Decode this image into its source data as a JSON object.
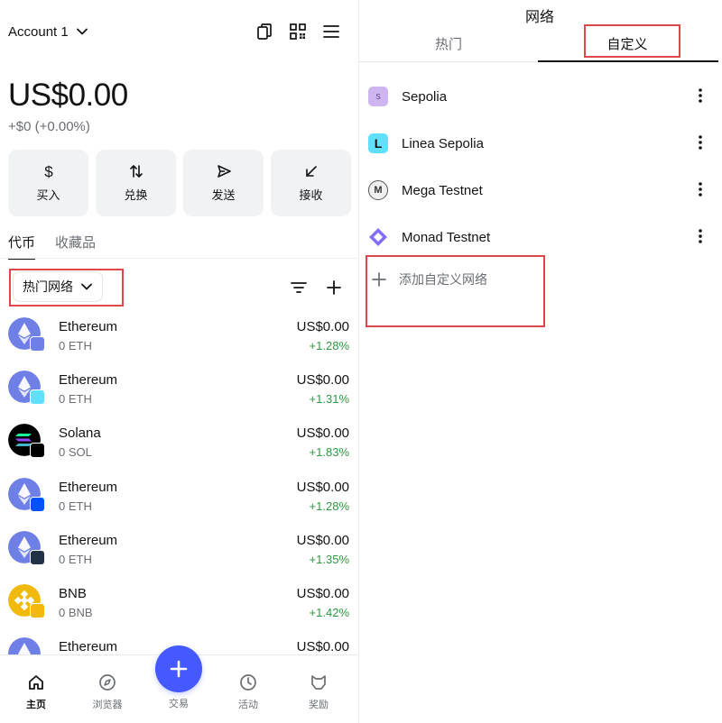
{
  "left": {
    "account": {
      "name": "Account 1"
    },
    "header_icons": [
      "copy-icon",
      "qr-code-icon",
      "menu-icon"
    ],
    "balance": "US$0.00",
    "change": "+$0 (+0.00%)",
    "actions": [
      {
        "label": "买入",
        "icon": "dollar-icon"
      },
      {
        "label": "兑换",
        "icon": "swap-icon"
      },
      {
        "label": "发送",
        "icon": "send-icon"
      },
      {
        "label": "接收",
        "icon": "receive-icon"
      }
    ],
    "tabs": [
      {
        "label": "代币",
        "active": true
      },
      {
        "label": "收藏品",
        "active": false
      }
    ],
    "network_filter": "热门网络",
    "tokens": [
      {
        "name": "Ethereum",
        "amount": "0 ETH",
        "value": "US$0.00",
        "change": "+1.28%",
        "logo": "ethereum",
        "badge": "ethereum"
      },
      {
        "name": "Ethereum",
        "amount": "0 ETH",
        "value": "US$0.00",
        "change": "+1.31%",
        "logo": "ethereum",
        "badge": "linea"
      },
      {
        "name": "Solana",
        "amount": "0 SOL",
        "value": "US$0.00",
        "change": "+1.83%",
        "logo": "solana",
        "badge": "solana"
      },
      {
        "name": "Ethereum",
        "amount": "0 ETH",
        "value": "US$0.00",
        "change": "+1.28%",
        "logo": "ethereum",
        "badge": "base"
      },
      {
        "name": "Ethereum",
        "amount": "0 ETH",
        "value": "US$0.00",
        "change": "+1.35%",
        "logo": "ethereum",
        "badge": "arbitrum"
      },
      {
        "name": "BNB",
        "amount": "0 BNB",
        "value": "US$0.00",
        "change": "+1.42%",
        "logo": "bnb",
        "badge": "bnb"
      },
      {
        "name": "Ethereum",
        "amount": "",
        "value": "US$0.00",
        "change": "",
        "logo": "ethereum",
        "badge": ""
      }
    ],
    "nav": [
      {
        "label": "主页",
        "icon": "home-icon",
        "active": true
      },
      {
        "label": "浏览器",
        "icon": "compass-icon",
        "active": false
      },
      {
        "label": "交易",
        "icon": "plus-icon",
        "active": false
      },
      {
        "label": "活动",
        "icon": "clock-icon",
        "active": false
      },
      {
        "label": "奖励",
        "icon": "rewards-icon",
        "active": false
      }
    ]
  },
  "right": {
    "title": "网络",
    "tabs": [
      {
        "label": "热门",
        "active": false
      },
      {
        "label": "自定义",
        "active": true
      }
    ],
    "networks": [
      {
        "name": "Sepolia",
        "logo_text": "S",
        "color": "#cfb5f0"
      },
      {
        "name": "Linea Sepolia",
        "logo_text": "L",
        "color": "#61dfff"
      },
      {
        "name": "Mega Testnet",
        "logo_text": "M",
        "color": "#efefef"
      },
      {
        "name": "Monad Testnet",
        "logo_text": "",
        "color": "#836ef9"
      }
    ],
    "add_network": "添加自定义网络"
  },
  "colors": {
    "accent": "#4459ff",
    "positive": "#2c9a3f",
    "highlight": "#e0474c"
  }
}
